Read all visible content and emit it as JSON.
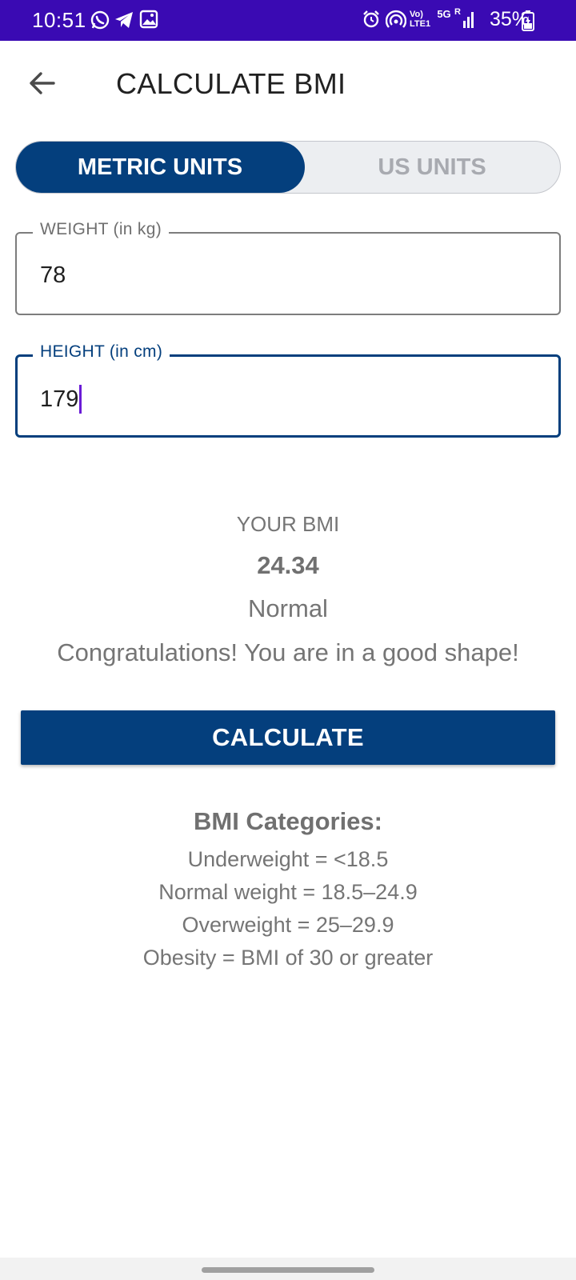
{
  "status_bar": {
    "time": "10:51",
    "battery": "35%",
    "volte_text": "Vo) LTE1",
    "network_5g": "5G",
    "signal_r": "R",
    "icons": [
      "whatsapp-icon",
      "telegram-icon",
      "gallery-icon",
      "alarm-icon",
      "hotspot-icon",
      "volte-icon",
      "5g-icon",
      "signal-icon",
      "battery-icon"
    ]
  },
  "app_bar": {
    "title": "CALCULATE BMI",
    "back_icon": "arrow-back-icon"
  },
  "units_toggle": {
    "metric_label": "METRIC UNITS",
    "us_label": "US UNITS",
    "selected": "METRIC UNITS"
  },
  "weight_field": {
    "label": "WEIGHT (in kg)",
    "value": "78"
  },
  "height_field": {
    "label": "HEIGHT (in cm)",
    "value": "179"
  },
  "result": {
    "label": "YOUR BMI",
    "value": "24.34",
    "status": "Normal",
    "message": "Congratulations! You are in a good shape!"
  },
  "calculate_button": {
    "label": "CALCULATE"
  },
  "categories": {
    "title": "BMI Categories:",
    "items": [
      "Underweight = <18.5",
      "Normal weight = 18.5–24.9",
      "Overweight = 25–29.9",
      "Obesity = BMI of 30 or greater"
    ]
  },
  "colors": {
    "status_bar": "#3a0ab3",
    "primary": "#043f7d",
    "cursor": "#6a1bd6",
    "muted_text": "#757575"
  }
}
